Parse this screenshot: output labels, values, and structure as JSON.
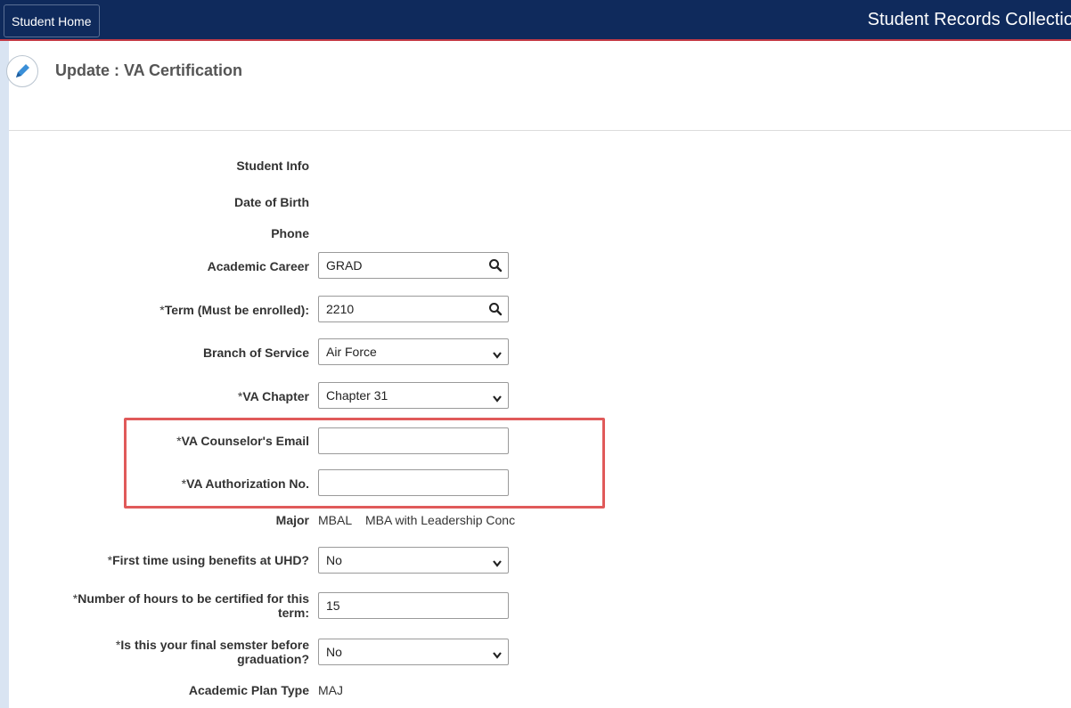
{
  "topbar": {
    "home_label": "Student Home",
    "app_title": "Student Records Collection"
  },
  "page": {
    "title": "Update :  VA Certification",
    "icon": "pencil-icon"
  },
  "form": {
    "student_info_label": "Student Info",
    "dob_label": "Date of Birth",
    "phone_label": "Phone",
    "academic_career": {
      "label": "Academic Career",
      "value": "GRAD"
    },
    "term": {
      "label": "Term (Must be enrolled):",
      "value": "2210"
    },
    "branch": {
      "label": "Branch of Service",
      "value": "Air Force"
    },
    "va_chapter": {
      "label": "VA Chapter",
      "value": "Chapter 31"
    },
    "va_email": {
      "label": "VA Counselor's Email",
      "value": ""
    },
    "va_auth": {
      "label": "VA Authorization No.",
      "value": ""
    },
    "major": {
      "label": "Major",
      "code": "MBAL",
      "desc": "MBA with Leadership Conc"
    },
    "first_time": {
      "label": "First time using benefits at UHD?",
      "value": "No"
    },
    "hours": {
      "label_line1": "Number of hours to be certified for this",
      "label_line2": "term:",
      "value": "15"
    },
    "final_sem": {
      "label_line1": "Is this your final semster before",
      "label_line2": "graduation?",
      "value": "No"
    },
    "plan_type": {
      "label": "Academic Plan Type",
      "value": "MAJ"
    },
    "required_marker": "*"
  },
  "colors": {
    "topbar": "#0f2a5c",
    "highlight": "#e05a5a",
    "accent_line": "#c33a45"
  }
}
